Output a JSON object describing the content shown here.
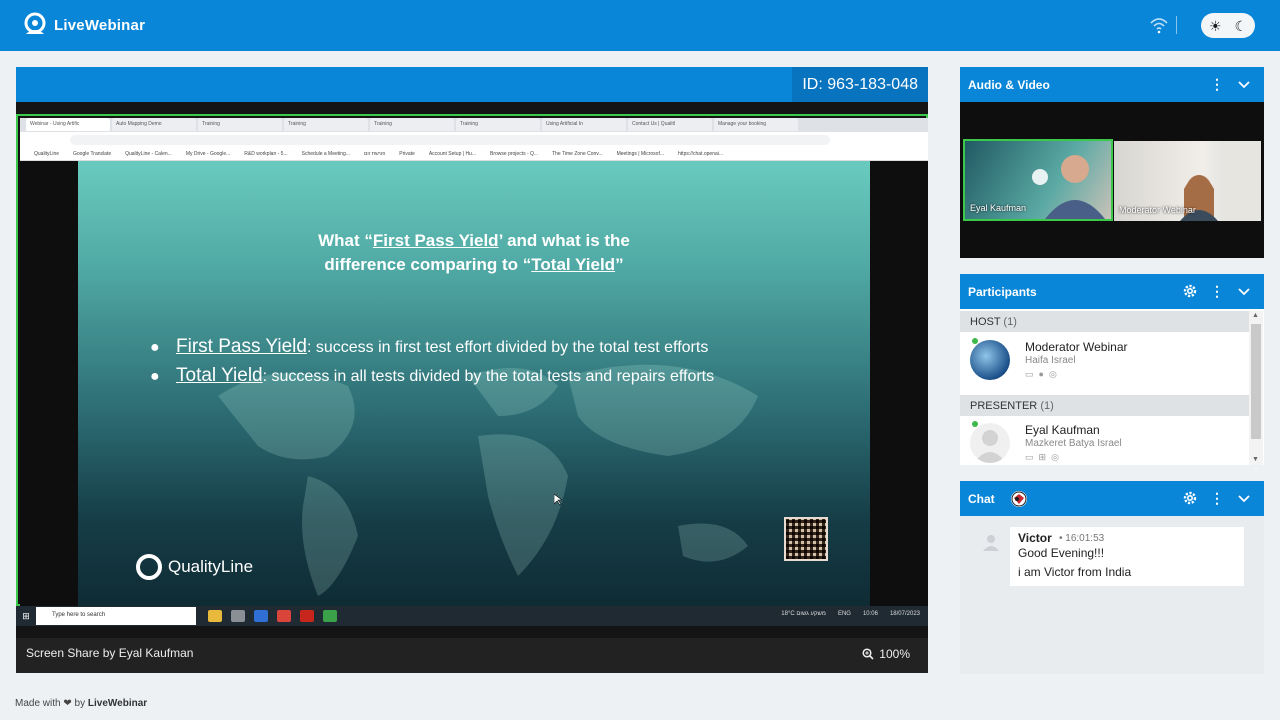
{
  "app": {
    "name": "LiveWebinar"
  },
  "topbar": {
    "sun_icon": "☀",
    "moon_icon": "☾"
  },
  "stage": {
    "id_label": "ID: 963-183-048",
    "share_label": "Screen Share by Eyal Kaufman",
    "zoom_label": "100%"
  },
  "browser": {
    "tabs": [
      "Webinar - Using Artific",
      "Auto Mapping Demo",
      "Training",
      "Training",
      "Training",
      "Training",
      "Using Artificial In",
      "Contact Us | Qualitl",
      "Manage your booking"
    ],
    "bookmarks": [
      "QualityLine",
      "Google Translate",
      "QualityLine - Calen...",
      "My Drive - Google...",
      "R&D workplan - 5...",
      "Schedule a Meeting...",
      "פגישת זום",
      "Private",
      "Account Setup | Hu...",
      "Browse projects - Q...",
      "The Time Zone Conv...",
      "Meetings | Microsof...",
      "https://chat.openai..."
    ]
  },
  "slide": {
    "title_pre": "What “",
    "title_term1": "First Pass Yield",
    "title_mid": "’ and what is the",
    "title_line2_pre": "difference comparing to “",
    "title_term2": "Total Yield",
    "title_line2_post": "”",
    "bullets": [
      {
        "term": "First Pass Yield",
        "text": ": success in first test effort divided by the total test efforts"
      },
      {
        "term": "Total Yield",
        "text": ": success in all tests divided by the total tests and repairs efforts"
      }
    ],
    "logo_text": "QualityLine"
  },
  "taskbar": {
    "search_placeholder": "Type here to search",
    "weather": "18°C משקע גשום",
    "lang": "ENG",
    "time": "10:06",
    "date": "18/07/2023"
  },
  "audio_video": {
    "title": "Audio & Video",
    "videos": [
      {
        "name": "Eyal Kaufman"
      },
      {
        "name": "Moderator Webinar"
      }
    ]
  },
  "participants": {
    "title": "Participants",
    "groups": [
      {
        "label": "HOST",
        "count": "(1)",
        "users": [
          {
            "name": "Moderator Webinar",
            "location": "Haifa Israel"
          }
        ]
      },
      {
        "label": "PRESENTER",
        "count": "(1)",
        "users": [
          {
            "name": "Eyal Kaufman",
            "location": "Mazkeret Batya Israel"
          }
        ]
      }
    ]
  },
  "chat": {
    "title": "Chat",
    "messages": [
      {
        "author": "Victor",
        "time": "16:01:53",
        "lines": [
          "Good Evening!!!",
          "i am Victor from India"
        ]
      }
    ]
  },
  "footer": {
    "made_with": "Made with",
    "by": "by",
    "brand": "LiveWebinar"
  },
  "colors": {
    "brand_blue": "#0a86d8",
    "active_green": "#3cc84a",
    "online_green": "#3cb94a"
  }
}
